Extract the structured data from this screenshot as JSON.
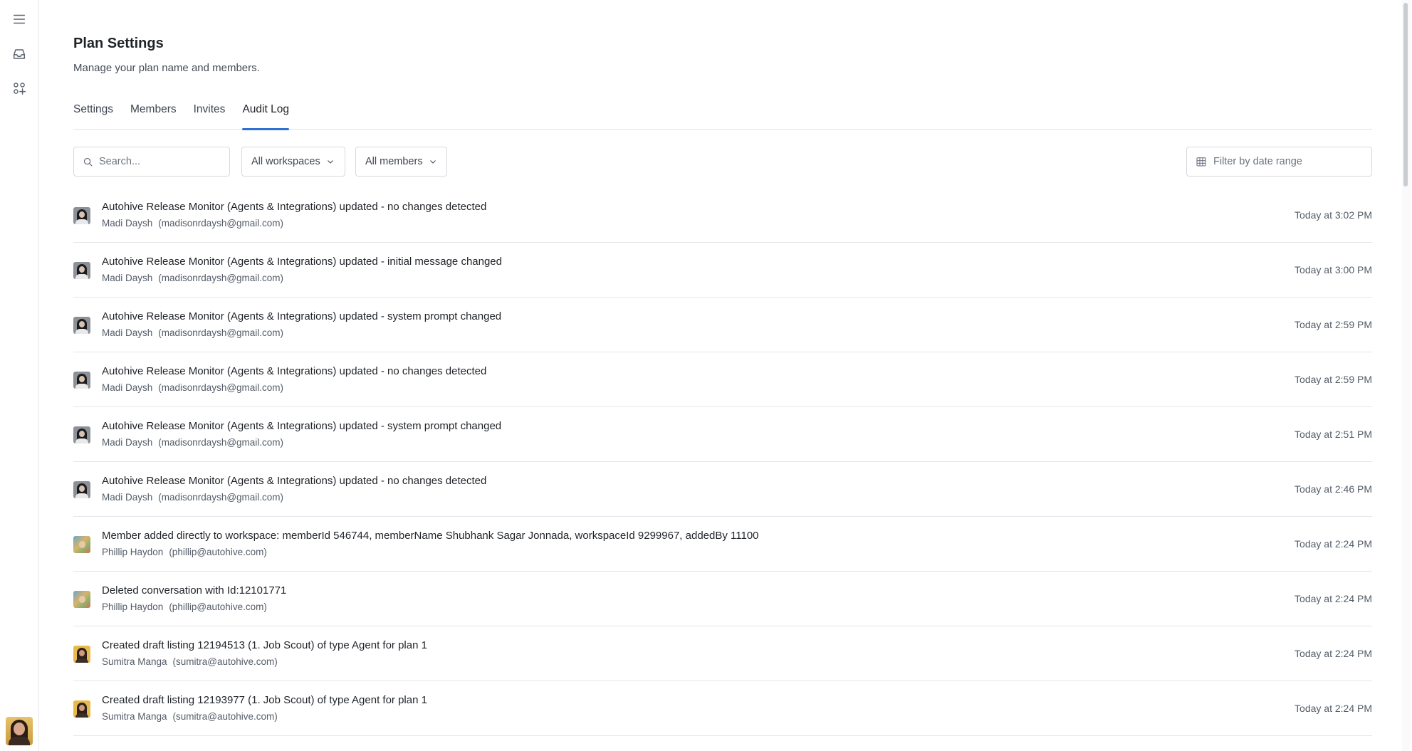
{
  "rail": {
    "icons": [
      "menu-icon",
      "inbox-icon",
      "apps-icon"
    ],
    "avatar": "user-avatar"
  },
  "header": {
    "title": "Plan Settings",
    "subtitle": "Manage your plan name and members."
  },
  "tabs": [
    {
      "label": "Settings",
      "active": false
    },
    {
      "label": "Members",
      "active": false
    },
    {
      "label": "Invites",
      "active": false
    },
    {
      "label": "Audit Log",
      "active": true
    }
  ],
  "filters": {
    "search_placeholder": "Search...",
    "workspaces_label": "All workspaces",
    "members_label": "All members",
    "date_placeholder": "Filter by date range"
  },
  "colors": {
    "accent": "#2f6fd6",
    "divider": "#e3e6ea"
  },
  "audit_log": [
    {
      "message": "Autohive Release Monitor (Agents & Integrations) updated - no changes detected",
      "user": "Madi Daysh",
      "email": "(madisonrdaysh@gmail.com)",
      "time": "Today at 3:02 PM",
      "avatar": "madi"
    },
    {
      "message": "Autohive Release Monitor (Agents & Integrations) updated - initial message changed",
      "user": "Madi Daysh",
      "email": "(madisonrdaysh@gmail.com)",
      "time": "Today at 3:00 PM",
      "avatar": "madi"
    },
    {
      "message": "Autohive Release Monitor (Agents & Integrations) updated - system prompt changed",
      "user": "Madi Daysh",
      "email": "(madisonrdaysh@gmail.com)",
      "time": "Today at 2:59 PM",
      "avatar": "madi"
    },
    {
      "message": "Autohive Release Monitor (Agents & Integrations) updated - no changes detected",
      "user": "Madi Daysh",
      "email": "(madisonrdaysh@gmail.com)",
      "time": "Today at 2:59 PM",
      "avatar": "madi"
    },
    {
      "message": "Autohive Release Monitor (Agents & Integrations) updated - system prompt changed",
      "user": "Madi Daysh",
      "email": "(madisonrdaysh@gmail.com)",
      "time": "Today at 2:51 PM",
      "avatar": "madi"
    },
    {
      "message": "Autohive Release Monitor (Agents & Integrations) updated - no changes detected",
      "user": "Madi Daysh",
      "email": "(madisonrdaysh@gmail.com)",
      "time": "Today at 2:46 PM",
      "avatar": "madi"
    },
    {
      "message": "Member added directly to workspace: memberId 546744, memberName Shubhank Sagar Jonnada, workspaceId 9299967, addedBy 11100",
      "user": "Phillip Haydon",
      "email": "(phillip@autohive.com)",
      "time": "Today at 2:24 PM",
      "avatar": "phil"
    },
    {
      "message": "Deleted conversation with Id:12101771",
      "user": "Phillip Haydon",
      "email": "(phillip@autohive.com)",
      "time": "Today at 2:24 PM",
      "avatar": "phil"
    },
    {
      "message": "Created draft listing 12194513 (1. Job Scout) of type Agent for plan 1",
      "user": "Sumitra Manga",
      "email": "(sumitra@autohive.com)",
      "time": "Today at 2:24 PM",
      "avatar": "sumi"
    },
    {
      "message": "Created draft listing 12193977 (1. Job Scout) of type Agent for plan 1",
      "user": "Sumitra Manga",
      "email": "(sumitra@autohive.com)",
      "time": "Today at 2:24 PM",
      "avatar": "sumi"
    }
  ]
}
